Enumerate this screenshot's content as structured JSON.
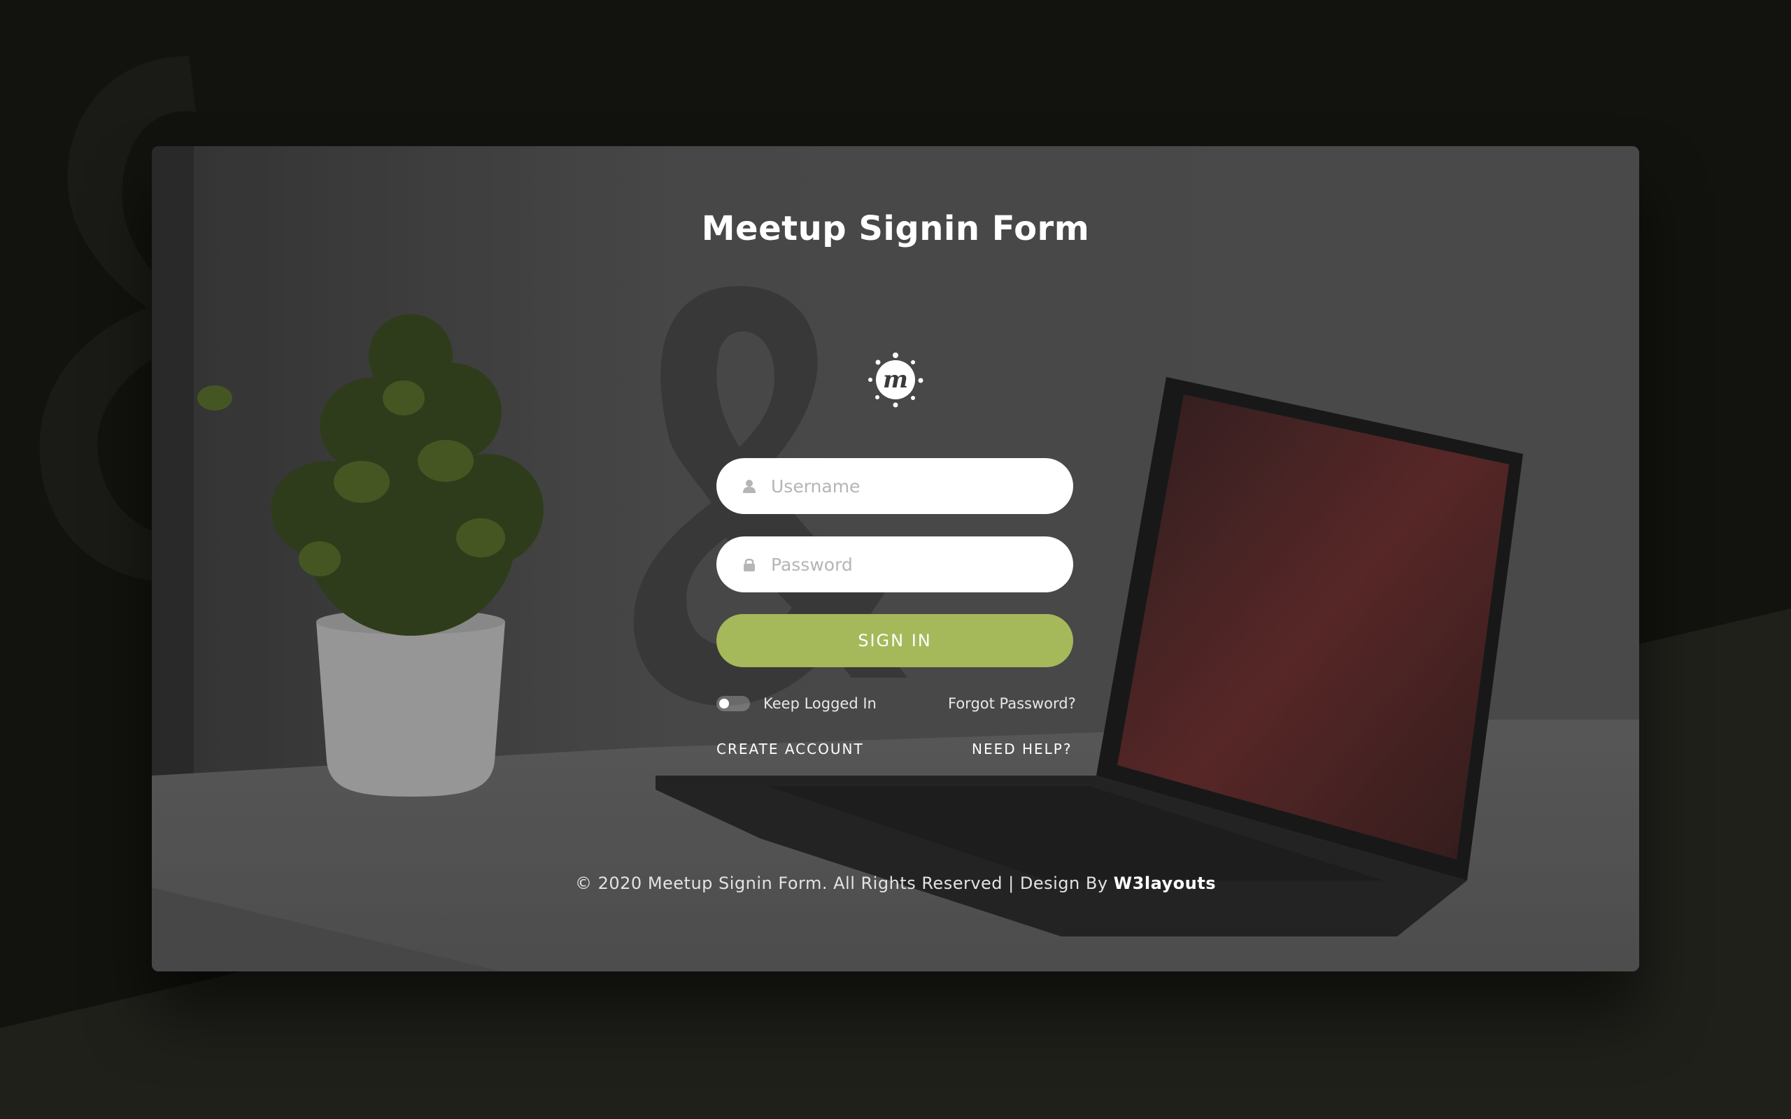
{
  "page": {
    "title": "Meetup Signin Form"
  },
  "logo": {
    "icon": "meetup-logo-icon",
    "letter": "m"
  },
  "form": {
    "username_placeholder": "Username",
    "username_value": "",
    "username_icon": "user-icon",
    "password_placeholder": "Password",
    "password_value": "",
    "password_icon": "lock-icon",
    "signin_label": "SIGN IN",
    "keep_logged_in_label": "Keep Logged In",
    "keep_logged_in_checked": false,
    "forgot_password_label": "Forgot Password?"
  },
  "links": {
    "create_account": "CREATE ACCOUNT",
    "need_help": "NEED HELP?"
  },
  "footer": {
    "text": "© 2020 Meetup Signin Form. All Rights Reserved | Design By ",
    "link_text": "W3layouts"
  },
  "colors": {
    "accent": "#a5b95a",
    "page_background": "#12130e",
    "card_overlay": "#4f4f4f"
  }
}
